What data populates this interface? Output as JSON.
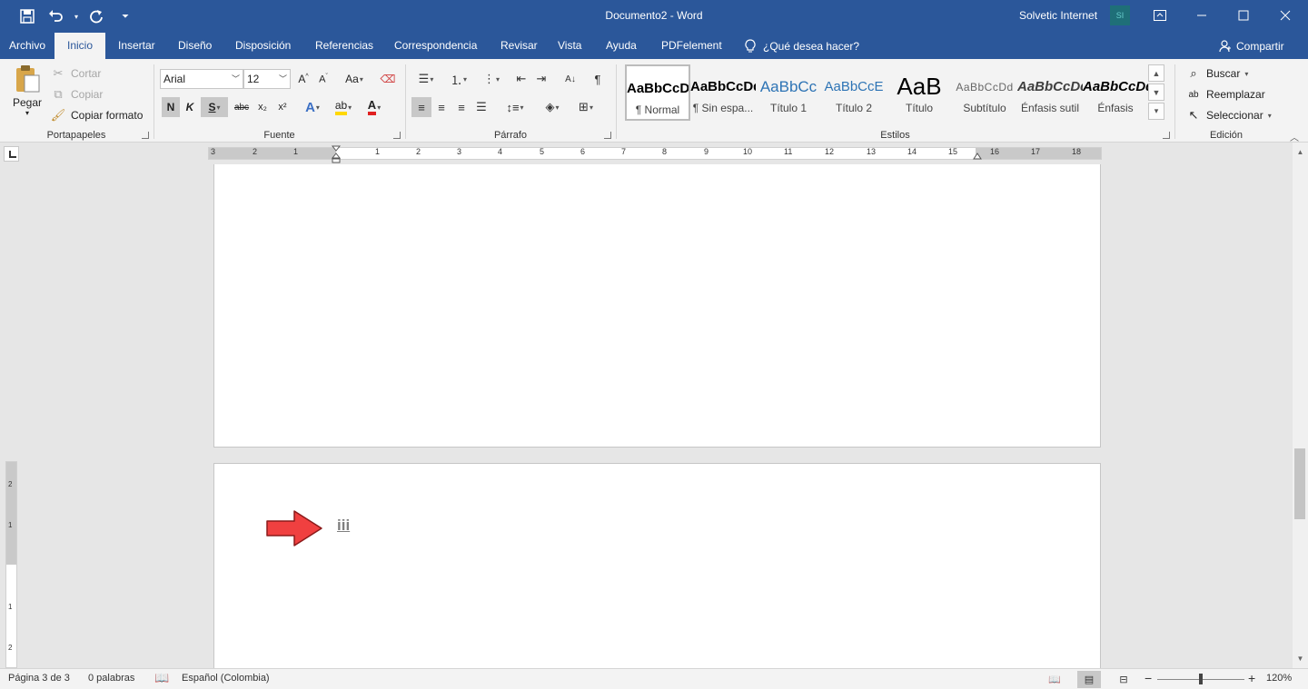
{
  "window": {
    "title": "Documento2  -  Word",
    "user": "Solvetic Internet",
    "avatar_initials": "SI"
  },
  "tabs": [
    "Archivo",
    "Inicio",
    "Insertar",
    "Diseño",
    "Disposición",
    "Referencias",
    "Correspondencia",
    "Revisar",
    "Vista",
    "Ayuda",
    "PDFelement"
  ],
  "active_tab": "Inicio",
  "tell_me": "¿Qué desea hacer?",
  "share": "Compartir",
  "clipboard": {
    "label": "Portapapeles",
    "paste": "Pegar",
    "cut": "Cortar",
    "copy": "Copiar",
    "format_painter": "Copiar formato"
  },
  "font": {
    "label": "Fuente",
    "name": "Arial",
    "size": "12",
    "bold": "N",
    "italic": "K",
    "underline": "S",
    "strike": "abc",
    "subscript": "x₂",
    "superscript": "x²",
    "change_case": "Aa"
  },
  "paragraph": {
    "label": "Párrafo"
  },
  "styles": {
    "label": "Estilos",
    "items": [
      {
        "sample": "AaBbCcDd",
        "name": "¶ Normal"
      },
      {
        "sample": "AaBbCcDd",
        "name": "¶ Sin espa..."
      },
      {
        "sample": "AaBbCc",
        "name": "Título 1"
      },
      {
        "sample": "AaBbCcE",
        "name": "Título 2"
      },
      {
        "sample": "AaB",
        "name": "Título"
      },
      {
        "sample": "AaBbCcDd",
        "name": "Subtítulo"
      },
      {
        "sample": "AaBbCcDd",
        "name": "Énfasis sutil"
      },
      {
        "sample": "AaBbCcDd",
        "name": "Énfasis"
      }
    ]
  },
  "editing": {
    "label": "Edición",
    "find": "Buscar",
    "replace": "Reemplazar",
    "select": "Seleccionar"
  },
  "ruler": {
    "left_numbers": [
      "3",
      "2",
      "1"
    ],
    "right_numbers": [
      "1",
      "2",
      "3",
      "4",
      "5",
      "6",
      "7",
      "8",
      "9",
      "10",
      "11",
      "12",
      "13",
      "14",
      "15",
      "16",
      "17",
      "18"
    ],
    "vertical_numbers": [
      "2",
      "1",
      "1",
      "2"
    ]
  },
  "document": {
    "page_number_text": "iii"
  },
  "status": {
    "page": "Página 3 de 3",
    "words": "0 palabras",
    "language": "Español (Colombia)",
    "zoom": "120%"
  },
  "colors": {
    "word_blue": "#2b579a",
    "highlight_yellow": "#ffd800",
    "font_color_red": "#e02020",
    "arrow_red": "#f04040"
  }
}
